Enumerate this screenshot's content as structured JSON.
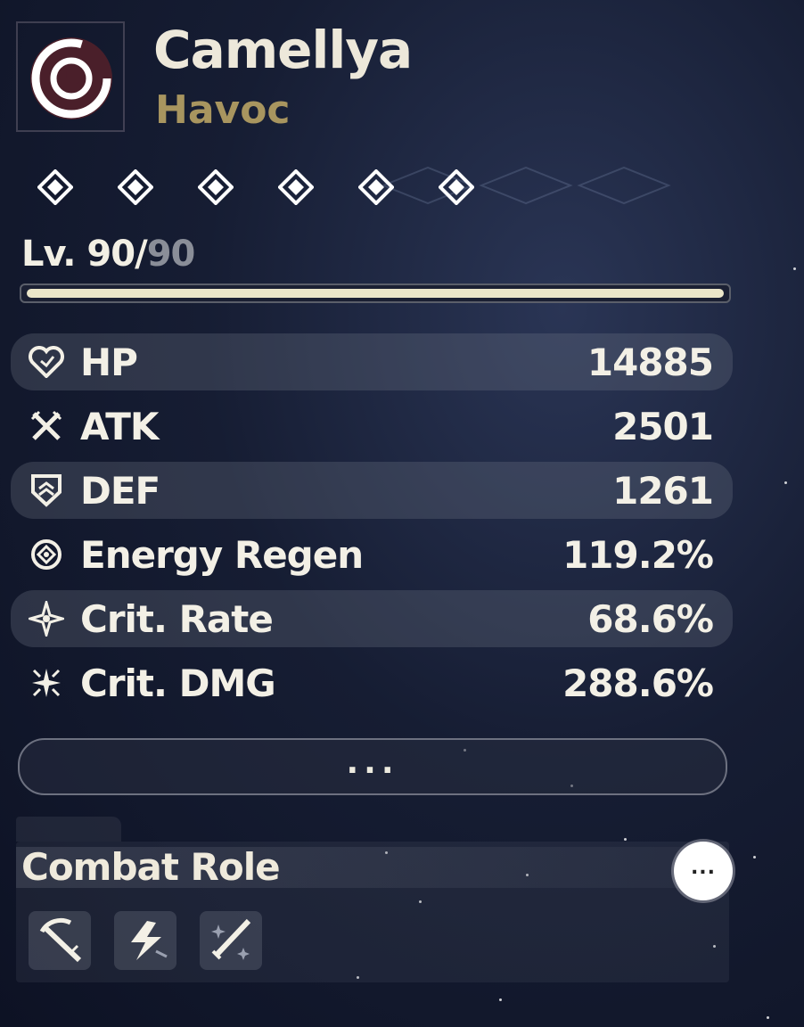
{
  "character": {
    "name": "Camellya",
    "element": "Havoc",
    "level": "Lv. 90/",
    "level_max": "90",
    "level_progress": 1.0,
    "sequence_nodes": 6
  },
  "stats": [
    {
      "label": "HP",
      "value": "14885",
      "icon": "heart-icon"
    },
    {
      "label": "ATK",
      "value": "2501",
      "icon": "crossed-swords-icon"
    },
    {
      "label": "DEF",
      "value": "1261",
      "icon": "shield-icon"
    },
    {
      "label": "Energy Regen",
      "value": "119.2%",
      "icon": "energy-icon"
    },
    {
      "label": "Crit. Rate",
      "value": "68.6%",
      "icon": "star-icon"
    },
    {
      "label": "Crit. DMG",
      "value": "288.6%",
      "icon": "burst-star-icon"
    }
  ],
  "more_button": "...",
  "combat_role": {
    "title": "Combat Role",
    "info_label": "...",
    "icons": [
      "scythe-blade-icon",
      "lightning-burst-icon",
      "sword-sparkle-icon"
    ]
  },
  "colors": {
    "element": "#a8955f",
    "emblem_bg": "#4a1f2a",
    "text": "#f3f0e6"
  }
}
